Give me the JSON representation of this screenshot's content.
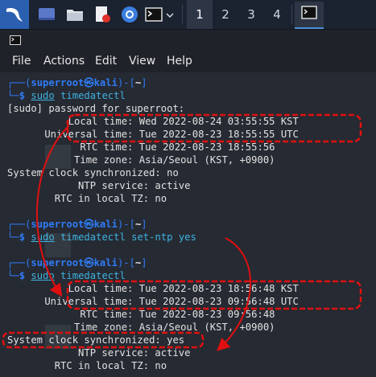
{
  "taskbar": {
    "workspaces": [
      "1",
      "2",
      "3",
      "4"
    ],
    "active_workspace": "1"
  },
  "menubar": {
    "items": [
      "File",
      "Actions",
      "Edit",
      "View",
      "Help"
    ]
  },
  "terminal": {
    "prompt1": {
      "user_host": "superroot㉿kali",
      "cwd": "~",
      "sudo": "sudo",
      "command": "timedatectl"
    },
    "password_prompt": "[sudo] password for superroot:",
    "output1": [
      "     Local time: Wed 2022-08-24 03:55:55 KST",
      " Universal time: Tue 2022-08-23 18:55:55 UTC",
      "       RTC time: Tue 2022-08-23 18:55:56",
      "      Time zone: Asia/Seoul (KST, +0900)",
      "System clock synchronized: no",
      "            NTP service: active",
      "        RTC in local TZ: no"
    ],
    "prompt2": {
      "user_host": "superroot㉿kali",
      "cwd": "~",
      "sudo": "sudo",
      "command": "timedatectl set-ntp yes"
    },
    "prompt3": {
      "user_host": "superroot㉿kali",
      "cwd": "~",
      "sudo": "sudo",
      "command": "timedatectl"
    },
    "output2": [
      "     Local time: Tue 2022-08-23 18:56:48 KST",
      " Universal time: Tue 2022-08-23 09:56:48 UTC",
      "       RTC time: Tue 2022-08-23 09:56:48",
      "      Time zone: Asia/Seoul (KST, +0900)",
      "System clock synchronized: yes",
      "            NTP service: active",
      "        RTC in local TZ: no"
    ]
  },
  "colors": {
    "annotation": "#e01010",
    "prompt_blue": "#2f7cf6",
    "command_cyan": "#3fb3e0"
  }
}
